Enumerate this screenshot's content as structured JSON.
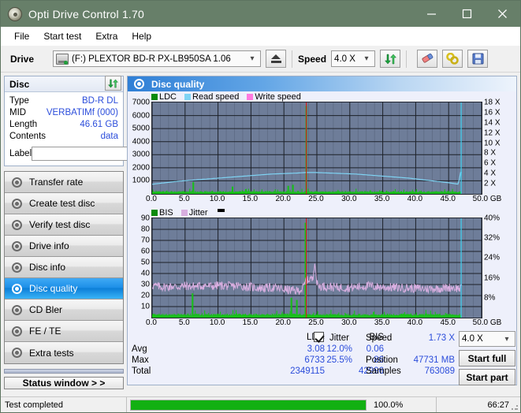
{
  "window": {
    "title": "Opti Drive Control 1.70",
    "app_icon": "disc-icon",
    "minimize": "minimize-icon",
    "maximize": "maximize-icon",
    "close": "close-icon"
  },
  "menu": {
    "items": [
      "File",
      "Start test",
      "Extra",
      "Help"
    ]
  },
  "toolbar": {
    "drive_label": "Drive",
    "drive_value": "(F:)   PLEXTOR BD-R  PX-LB950SA 1.06",
    "eject_icon": "eject-icon",
    "speed_label": "Speed",
    "speed_value": "4.0 X",
    "refresh_icon": "refresh-icon",
    "erase_icon": "eraser-icon",
    "settings_icon": "tools-icon",
    "save_icon": "save-icon"
  },
  "disc": {
    "header": "Disc",
    "refresh_icon": "refresh-icon",
    "rows": [
      {
        "key": "Type",
        "value": "BD-R DL"
      },
      {
        "key": "MID",
        "value": "VERBATIMf (000)"
      },
      {
        "key": "Length",
        "value": "46.61 GB"
      },
      {
        "key": "Contents",
        "value": "data"
      }
    ],
    "label_key": "Label",
    "label_value": "",
    "label_placeholder": "",
    "disc_button_icon": "cd-icon"
  },
  "nav": {
    "items": [
      {
        "label": "Transfer rate",
        "icon": "disc-icon",
        "active": false
      },
      {
        "label": "Create test disc",
        "icon": "disc-icon",
        "active": false
      },
      {
        "label": "Verify test disc",
        "icon": "disc-icon",
        "active": false
      },
      {
        "label": "Drive info",
        "icon": "disc-icon",
        "active": false
      },
      {
        "label": "Disc info",
        "icon": "disc-icon",
        "active": false
      },
      {
        "label": "Disc quality",
        "icon": "disc-icon",
        "active": true
      },
      {
        "label": "CD Bler",
        "icon": "disc-icon",
        "active": false
      },
      {
        "label": "FE / TE",
        "icon": "disc-icon",
        "active": false
      },
      {
        "label": "Extra tests",
        "icon": "disc-icon",
        "active": false
      }
    ],
    "status_window": "Status window > >"
  },
  "panel": {
    "title": "Disc quality",
    "icon": "disc-icon"
  },
  "stats": {
    "col_headers": [
      "LDC",
      "BIS"
    ],
    "rows": [
      {
        "label": "Avg",
        "ldc": "3.08",
        "bis": "0.06",
        "jitter": "12.0%"
      },
      {
        "label": "Max",
        "ldc": "6733",
        "bis": "86",
        "jitter": "25.5%"
      },
      {
        "label": "Total",
        "ldc": "2349115",
        "bis": "42996",
        "jitter": ""
      }
    ],
    "jitter_label": "Jitter",
    "jitter_checked": true,
    "speed_label": "Speed",
    "speed_value": "1.73 X",
    "position_label": "Position",
    "position_value": "47731 MB",
    "samples_label": "Samples",
    "samples_value": "763089",
    "speed_select": "4.0 X",
    "start_full": "Start full",
    "start_part": "Start part"
  },
  "statusbar": {
    "message": "Test completed",
    "percent_text": "100.0%",
    "percent_value": 100,
    "elapsed": "66:27"
  },
  "colors": {
    "title_bar": "#677f69",
    "accent_blue": "#2b4ddb",
    "plot_bg": "#6e7d99",
    "ldc_green": "#16c216",
    "bis_green": "#16c216",
    "read_speed": "#7fd4f4",
    "write_speed": "#ff7ae0",
    "jitter_pink": "#d8aee0",
    "progress_green": "#12b012",
    "marker_cyan": "#3fd0f0",
    "marker_red": "#d02020"
  },
  "chart_data": [
    {
      "type": "line",
      "title": "LDC / Read speed vs position",
      "xlabel": "GB",
      "ylabel_left": "LDC errors",
      "ylabel_right": "Speed (X)",
      "x": [
        0.0,
        5.0,
        10.0,
        15.0,
        20.0,
        25.0,
        30.0,
        35.0,
        40.0,
        45.0,
        50.0
      ],
      "xtick_labels": [
        "0.0",
        "5.0",
        "10.0",
        "15.0",
        "20.0",
        "25.0",
        "30.0",
        "35.0",
        "40.0",
        "45.0",
        "50.0 GB"
      ],
      "ylim_left": [
        0,
        7000
      ],
      "ytick_labels_left": [
        "1000",
        "2000",
        "3000",
        "4000",
        "5000",
        "6000",
        "7000"
      ],
      "ylim_right": [
        0,
        18
      ],
      "ytick_labels_right": [
        "2 X",
        "4 X",
        "6 X",
        "8 X",
        "10 X",
        "12 X",
        "14 X",
        "16 X",
        "18 X"
      ],
      "legend": [
        {
          "name": "LDC",
          "color": "#16c216"
        },
        {
          "name": "Read speed",
          "color": "#7fd4f4"
        },
        {
          "name": "Write speed",
          "color": "#ff7ae0"
        }
      ],
      "legend_position": "top-left",
      "grid": true,
      "series": [
        {
          "name": "Read speed",
          "color": "#7fd4f4",
          "unit": "X",
          "x": [
            0.0,
            2.0,
            4.0,
            6.0,
            8.0,
            10.0,
            12.0,
            14.0,
            16.0,
            18.0,
            20.0,
            22.0,
            23.3,
            23.4,
            25.0,
            27.0,
            29.0,
            31.0,
            33.0,
            35.0,
            37.0,
            39.0,
            41.0,
            43.0,
            45.0,
            46.5,
            46.8,
            48.0
          ],
          "values": [
            1.9,
            2.2,
            2.5,
            2.7,
            2.9,
            3.1,
            3.3,
            3.5,
            3.7,
            3.9,
            4.0,
            4.1,
            4.2,
            4.2,
            4.2,
            4.1,
            4.0,
            3.9,
            3.7,
            3.5,
            3.3,
            3.1,
            2.8,
            2.5,
            2.2,
            1.9,
            4.2,
            4.2
          ]
        },
        {
          "name": "LDC",
          "color": "#16c216",
          "type": "impulse-band",
          "baseline": 120,
          "noise_max": 400,
          "peaks": [
            {
              "x": 6.2,
              "value": 900
            },
            {
              "x": 23.4,
              "value": 6733
            },
            {
              "x": 20.6,
              "value": 620
            },
            {
              "x": 21.4,
              "value": 700
            },
            {
              "x": 12.2,
              "value": 560
            }
          ]
        }
      ],
      "markers": [
        {
          "name": "red-position-marker",
          "x": 23.4,
          "color": "#d02020"
        },
        {
          "name": "cyan-end-marker",
          "x": 46.9,
          "color": "#3fd0f0"
        }
      ]
    },
    {
      "type": "line",
      "title": "BIS / Jitter vs position",
      "xlabel": "GB",
      "ylabel_left": "BIS errors",
      "ylabel_right": "Jitter %",
      "xtick_labels": [
        "0.0",
        "5.0",
        "10.0",
        "15.0",
        "20.0",
        "25.0",
        "30.0",
        "35.0",
        "40.0",
        "45.0",
        "50.0 GB"
      ],
      "ylim_left": [
        0,
        90
      ],
      "ytick_labels_left": [
        "10",
        "20",
        "30",
        "40",
        "50",
        "60",
        "70",
        "80",
        "90"
      ],
      "ylim_right": [
        0,
        40
      ],
      "ytick_labels_right": [
        "8%",
        "16%",
        "24%",
        "32%",
        "40%"
      ],
      "legend": [
        {
          "name": "BIS",
          "color": "#16c216"
        },
        {
          "name": "Jitter",
          "color": "#d8aee0"
        }
      ],
      "legend_position": "top-left",
      "grid": true,
      "series": [
        {
          "name": "Jitter",
          "color": "#d8aee0",
          "unit": "%",
          "x": [
            0.0,
            1.0,
            2.0,
            3.0,
            4.0,
            5.0,
            6.0,
            7.0,
            8.0,
            9.0,
            10.0,
            11.0,
            12.0,
            13.0,
            14.0,
            15.0,
            16.0,
            17.0,
            18.0,
            19.0,
            20.0,
            20.5,
            21.0,
            22.0,
            22.8,
            23.2,
            23.4,
            23.6,
            24.0,
            24.4,
            24.7,
            25.0,
            25.3,
            26.0,
            27.0,
            28.0,
            30.0,
            32.0,
            33.0,
            34.0,
            36.0,
            38.0,
            40.0,
            42.0,
            44.0,
            45.5,
            46.5
          ],
          "values": [
            13.0,
            12.5,
            12.3,
            12.6,
            12.4,
            12.8,
            12.5,
            12.7,
            12.9,
            12.6,
            13.0,
            12.8,
            12.6,
            12.9,
            12.5,
            12.3,
            12.0,
            11.9,
            12.1,
            11.8,
            11.5,
            11.2,
            11.0,
            10.8,
            11.5,
            13.5,
            15.8,
            14.8,
            16.0,
            15.0,
            24.0,
            13.5,
            12.8,
            12.6,
            12.4,
            12.2,
            12.0,
            12.6,
            12.8,
            12.4,
            12.2,
            12.0,
            11.8,
            11.6,
            11.9,
            12.2,
            11.8
          ]
        },
        {
          "name": "BIS",
          "color": "#16c216",
          "type": "impulse-band",
          "baseline": 2,
          "noise_max": 7,
          "peaks": [
            {
              "x": 23.3,
              "value": 86
            },
            {
              "x": 6.1,
              "value": 22
            },
            {
              "x": 21.1,
              "value": 18
            },
            {
              "x": 22.0,
              "value": 16
            }
          ]
        }
      ],
      "markers": [
        {
          "name": "red-position-marker",
          "x": 23.4,
          "color": "#d02020"
        },
        {
          "name": "cyan-end-marker",
          "x": 46.9,
          "color": "#3fd0f0"
        }
      ]
    }
  ]
}
